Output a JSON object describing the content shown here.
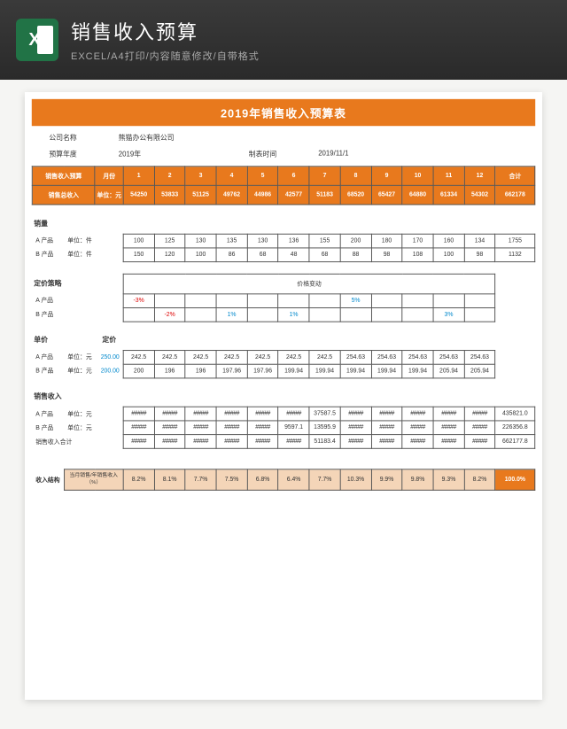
{
  "header": {
    "title": "销售收入预算",
    "subtitle": "EXCEL/A4打印/内容随意修改/自带格式",
    "icon": "X"
  },
  "doc_title": "2019年销售收入预算表",
  "info": {
    "company_l": "公司名称",
    "company_v": "熊猫办公有限公司",
    "year_l": "预算年度",
    "year_v": "2019年",
    "maker_l": "制表时间",
    "maker_v": "2019/11/1"
  },
  "cols": {
    "budget": "销售收入预算",
    "month": "月份",
    "total": "合计",
    "months": [
      "1",
      "2",
      "3",
      "4",
      "5",
      "6",
      "7",
      "8",
      "9",
      "10",
      "11",
      "12"
    ]
  },
  "total_row": {
    "label": "销售总收入",
    "unit": "单位：元",
    "vals": [
      "54250",
      "53833",
      "51125",
      "49762",
      "44986",
      "42577",
      "51183",
      "68520",
      "65427",
      "64880",
      "61334",
      "54302"
    ],
    "total": "662178"
  },
  "sales": {
    "label": "销量",
    "a": {
      "name": "A 产品",
      "unit": "单位：件",
      "vals": [
        "100",
        "125",
        "130",
        "135",
        "130",
        "136",
        "155",
        "200",
        "180",
        "170",
        "160",
        "134"
      ],
      "total": "1755"
    },
    "b": {
      "name": "B 产品",
      "unit": "单位：件",
      "vals": [
        "150",
        "120",
        "100",
        "86",
        "68",
        "48",
        "68",
        "88",
        "98",
        "108",
        "100",
        "98"
      ],
      "total": "1132"
    }
  },
  "pricing": {
    "label": "定价策略",
    "sub": "价格变动",
    "a": {
      "name": "A 产品",
      "vals": [
        "-3%",
        "",
        "",
        "",
        "",
        "",
        "",
        "5%",
        "",
        "",
        "",
        ""
      ]
    },
    "b": {
      "name": "B 产品",
      "vals": [
        "",
        "-2%",
        "",
        "1%",
        "",
        "1%",
        "",
        "",
        "",
        "",
        "3%",
        ""
      ]
    }
  },
  "unitprice": {
    "label": "单价",
    "sub": "定价",
    "a": {
      "name": "A 产品",
      "unit": "单位：元",
      "base": "250.00",
      "vals": [
        "242.5",
        "242.5",
        "242.5",
        "242.5",
        "242.5",
        "242.5",
        "242.5",
        "254.63",
        "254.63",
        "254.63",
        "254.63",
        "254.63"
      ]
    },
    "b": {
      "name": "B 产品",
      "unit": "单位：元",
      "base": "200.00",
      "vals": [
        "200",
        "196",
        "196",
        "197.96",
        "197.96",
        "199.94",
        "199.94",
        "199.94",
        "199.94",
        "199.94",
        "205.94",
        "205.94"
      ]
    }
  },
  "revenue": {
    "label": "销售收入",
    "a": {
      "name": "A 产品",
      "unit": "单位：元",
      "vals": [
        "#####",
        "#####",
        "#####",
        "#####",
        "#####",
        "#####",
        "37587.5",
        "#####",
        "#####",
        "#####",
        "#####",
        "#####"
      ],
      "total": "435821.0"
    },
    "b": {
      "name": "B 产品",
      "unit": "单位：元",
      "vals": [
        "#####",
        "#####",
        "#####",
        "#####",
        "#####",
        "9597.1",
        "13595.9",
        "#####",
        "#####",
        "#####",
        "#####",
        "#####"
      ],
      "total": "226356.8"
    },
    "sum": {
      "name": "销售收入合计",
      "vals": [
        "#####",
        "#####",
        "#####",
        "#####",
        "#####",
        "#####",
        "51183.4",
        "#####",
        "#####",
        "#####",
        "#####",
        "#####"
      ],
      "total": "662177.8"
    }
  },
  "structure": {
    "label": "收入结构",
    "sub": "当月销售/年销售收入（%）",
    "vals": [
      "8.2%",
      "8.1%",
      "7.7%",
      "7.5%",
      "6.8%",
      "6.4%",
      "7.7%",
      "10.3%",
      "9.9%",
      "9.8%",
      "9.3%",
      "8.2%"
    ],
    "total": "100.0%"
  }
}
